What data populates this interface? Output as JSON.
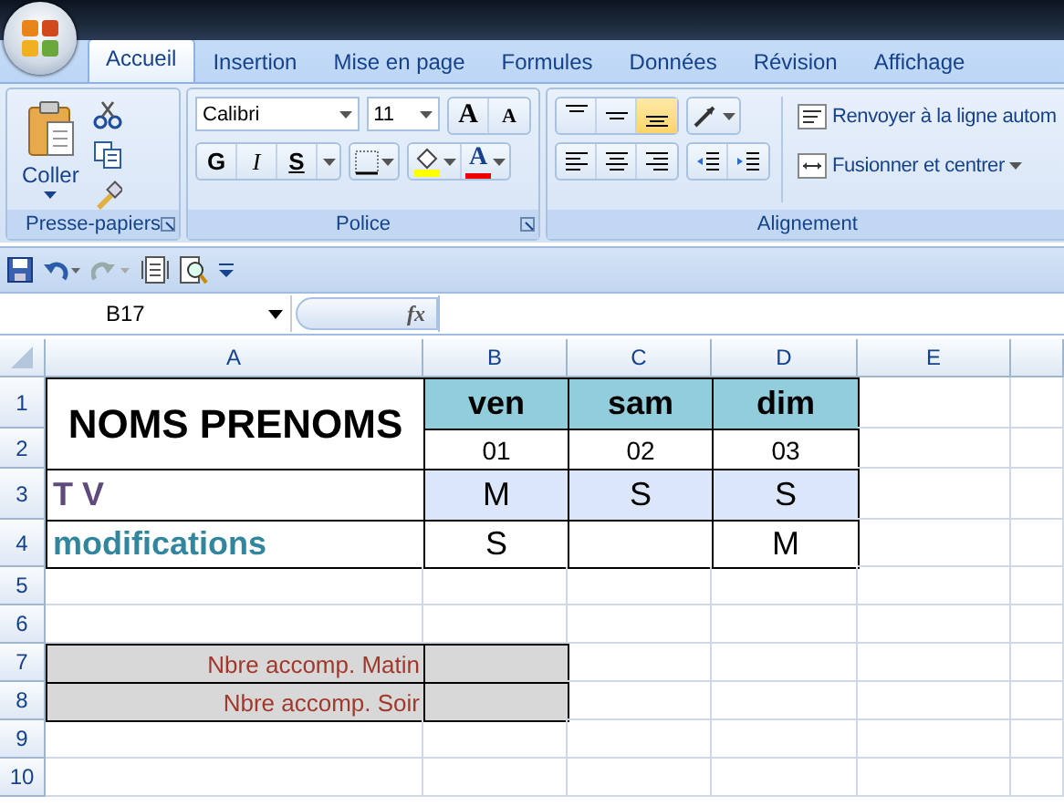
{
  "tabs": [
    {
      "label": "Accueil",
      "selected": true
    },
    {
      "label": "Insertion",
      "selected": false
    },
    {
      "label": "Mise en page",
      "selected": false
    },
    {
      "label": "Formules",
      "selected": false
    },
    {
      "label": "Données",
      "selected": false
    },
    {
      "label": "Révision",
      "selected": false
    },
    {
      "label": "Affichage",
      "selected": false
    }
  ],
  "ribbon": {
    "clipboard": {
      "paste_label": "Coller",
      "group_label": "Presse-papiers"
    },
    "font": {
      "name": "Calibri",
      "size": "11",
      "size_buttons": [
        "A",
        "A"
      ],
      "style_buttons": [
        "G",
        "I",
        "S"
      ],
      "color_button": "A",
      "group_label": "Police"
    },
    "alignment": {
      "vertical": [
        {
          "kind": "top",
          "selected": false
        },
        {
          "kind": "middle",
          "selected": false
        },
        {
          "kind": "bottom",
          "selected": true
        }
      ],
      "wrap_label": "Renvoyer à la ligne autom",
      "merge_label": "Fusionner et centrer",
      "group_label": "Alignement"
    }
  },
  "formula_bar": {
    "name_box": "B17",
    "function_label": "fx"
  },
  "sheet": {
    "columns": [
      "A",
      "B",
      "C",
      "D",
      "E"
    ],
    "rows": [
      {
        "header": "1",
        "cells": [
          {
            "kind": "title",
            "text": "NOMS PRENOMS",
            "merged_down": true
          },
          {
            "kind": "day",
            "text": "ven"
          },
          {
            "kind": "day",
            "text": "sam"
          },
          {
            "kind": "day",
            "text": "dim"
          }
        ]
      },
      {
        "header": "2",
        "cells": [
          {
            "kind": "merged"
          },
          {
            "kind": "date",
            "text": "01"
          },
          {
            "kind": "date",
            "text": "02"
          },
          {
            "kind": "date",
            "text": "03"
          }
        ]
      },
      {
        "header": "3",
        "cells": [
          {
            "kind": "row_label",
            "text": "T V",
            "color": "#604a7b"
          },
          {
            "kind": "shift_highlight",
            "text": "M"
          },
          {
            "kind": "shift_highlight",
            "text": "S"
          },
          {
            "kind": "shift_highlight",
            "text": "S"
          }
        ]
      },
      {
        "header": "4",
        "cells": [
          {
            "kind": "row_label",
            "text": "modifications",
            "color": "#31859c"
          },
          {
            "kind": "shift",
            "text": "S"
          },
          {
            "kind": "shift"
          },
          {
            "kind": "shift",
            "text": "M"
          }
        ]
      },
      {
        "header": "5",
        "cells": []
      },
      {
        "header": "6",
        "cells": []
      },
      {
        "header": "7",
        "cells": [
          {
            "kind": "note_label",
            "text": "Nbre accomp. Matin"
          },
          {
            "kind": "note_value"
          }
        ]
      },
      {
        "header": "8",
        "cells": [
          {
            "kind": "note_label",
            "text": "Nbre accomp. Soir"
          },
          {
            "kind": "note_value"
          }
        ]
      },
      {
        "header": "9",
        "cells": []
      },
      {
        "header": "10",
        "cells": []
      }
    ]
  }
}
